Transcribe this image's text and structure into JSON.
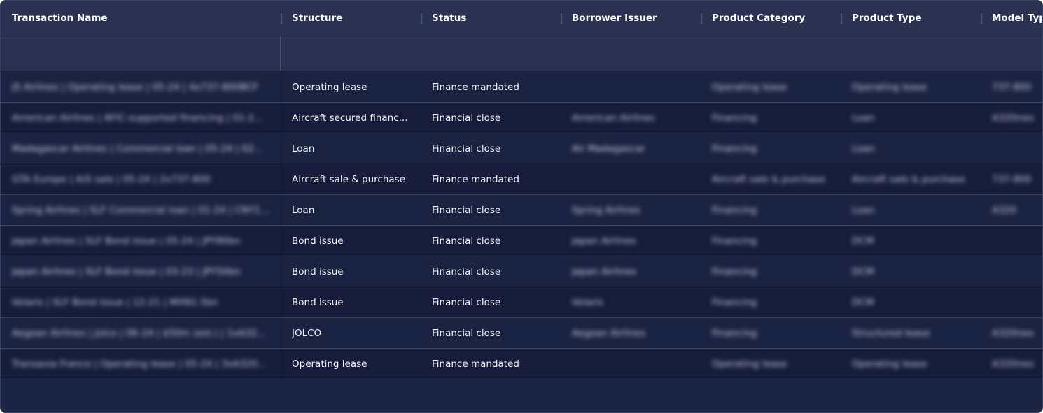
{
  "table": {
    "columns": [
      {
        "key": "transaction_name",
        "label": "Transaction Name"
      },
      {
        "key": "structure",
        "label": "Structure"
      },
      {
        "key": "status",
        "label": "Status"
      },
      {
        "key": "borrower_issuer",
        "label": "Borrower Issuer"
      },
      {
        "key": "product_category",
        "label": "Product Category"
      },
      {
        "key": "product_type",
        "label": "Product Type"
      },
      {
        "key": "model_type",
        "label": "Model Typ"
      }
    ],
    "rows": [
      {
        "transaction_name": "JS Airlines | Operating lease | 05-24 | 4x737-800BCF",
        "structure": "Operating lease",
        "status": "Finance mandated",
        "borrower_issuer": "",
        "product_category": "Operating lease",
        "product_type": "Operating lease",
        "model_type": "737-800"
      },
      {
        "transaction_name": "American Airlines | AFIC-supported financing | 01-2...",
        "structure": "Aircraft secured financ...",
        "status": "Financial close",
        "borrower_issuer": "American Airlines",
        "product_category": "Financing",
        "product_type": "Loan",
        "model_type": "A320neo"
      },
      {
        "transaction_name": "Madagascar Airlines | Commercial loan | 05-24 | 62...",
        "structure": "Loan",
        "status": "Financial close",
        "borrower_issuer": "Air Madagascar",
        "product_category": "Financing",
        "product_type": "Loan",
        "model_type": ""
      },
      {
        "transaction_name": "GTA Europe | A/S sale | 05-24 | 2x737-800",
        "structure": "Aircraft sale & purchase",
        "status": "Finance mandated",
        "borrower_issuer": "",
        "product_category": "Aircraft sale & purchase",
        "product_type": "Aircraft sale & purchase",
        "model_type": "737-800"
      },
      {
        "transaction_name": "Spring Airlines | SLF Commercial loan | 01-24 | CNY10...",
        "structure": "Loan",
        "status": "Financial close",
        "borrower_issuer": "Spring Airlines",
        "product_category": "Financing",
        "product_type": "Loan",
        "model_type": "A320"
      },
      {
        "transaction_name": "Japan Airlines | SLF Bond issue | 05-24 | JPY80bn",
        "structure": "Bond issue",
        "status": "Financial close",
        "borrower_issuer": "Japan Airlines",
        "product_category": "Financing",
        "product_type": "DCM",
        "model_type": ""
      },
      {
        "transaction_name": "Japan Airlines | SLF Bond issue | 03-23 | JPY50bn",
        "structure": "Bond issue",
        "status": "Financial close",
        "borrower_issuer": "Japan Airlines",
        "product_category": "Financing",
        "product_type": "DCM",
        "model_type": ""
      },
      {
        "transaction_name": "Volaris | SLF Bond issue | 12-21 | MXN1.5bn",
        "structure": "Bond issue",
        "status": "Financial close",
        "borrower_issuer": "Volaris",
        "product_category": "Financing",
        "product_type": "DCM",
        "model_type": ""
      },
      {
        "transaction_name": "Aegean Airlines | Jolco | 06-24 | $50m (est.) | 1xA32...",
        "structure": "JOLCO",
        "status": "Financial close",
        "borrower_issuer": "Aegean Airlines",
        "product_category": "Financing",
        "product_type": "Structured lease",
        "model_type": "A320neo"
      },
      {
        "transaction_name": "Transavia France | Operating lease | 05-24 | 3xA320...",
        "structure": "Operating lease",
        "status": "Finance mandated",
        "borrower_issuer": "",
        "product_category": "Operating lease",
        "product_type": "Operating lease",
        "model_type": "A320neo"
      }
    ]
  },
  "colors": {
    "header_bg": "#2b3150",
    "row_even_bg": "#1b2343",
    "row_odd_bg": "#161c3a",
    "border": "#4a5273",
    "text": "#f1f3f8"
  }
}
